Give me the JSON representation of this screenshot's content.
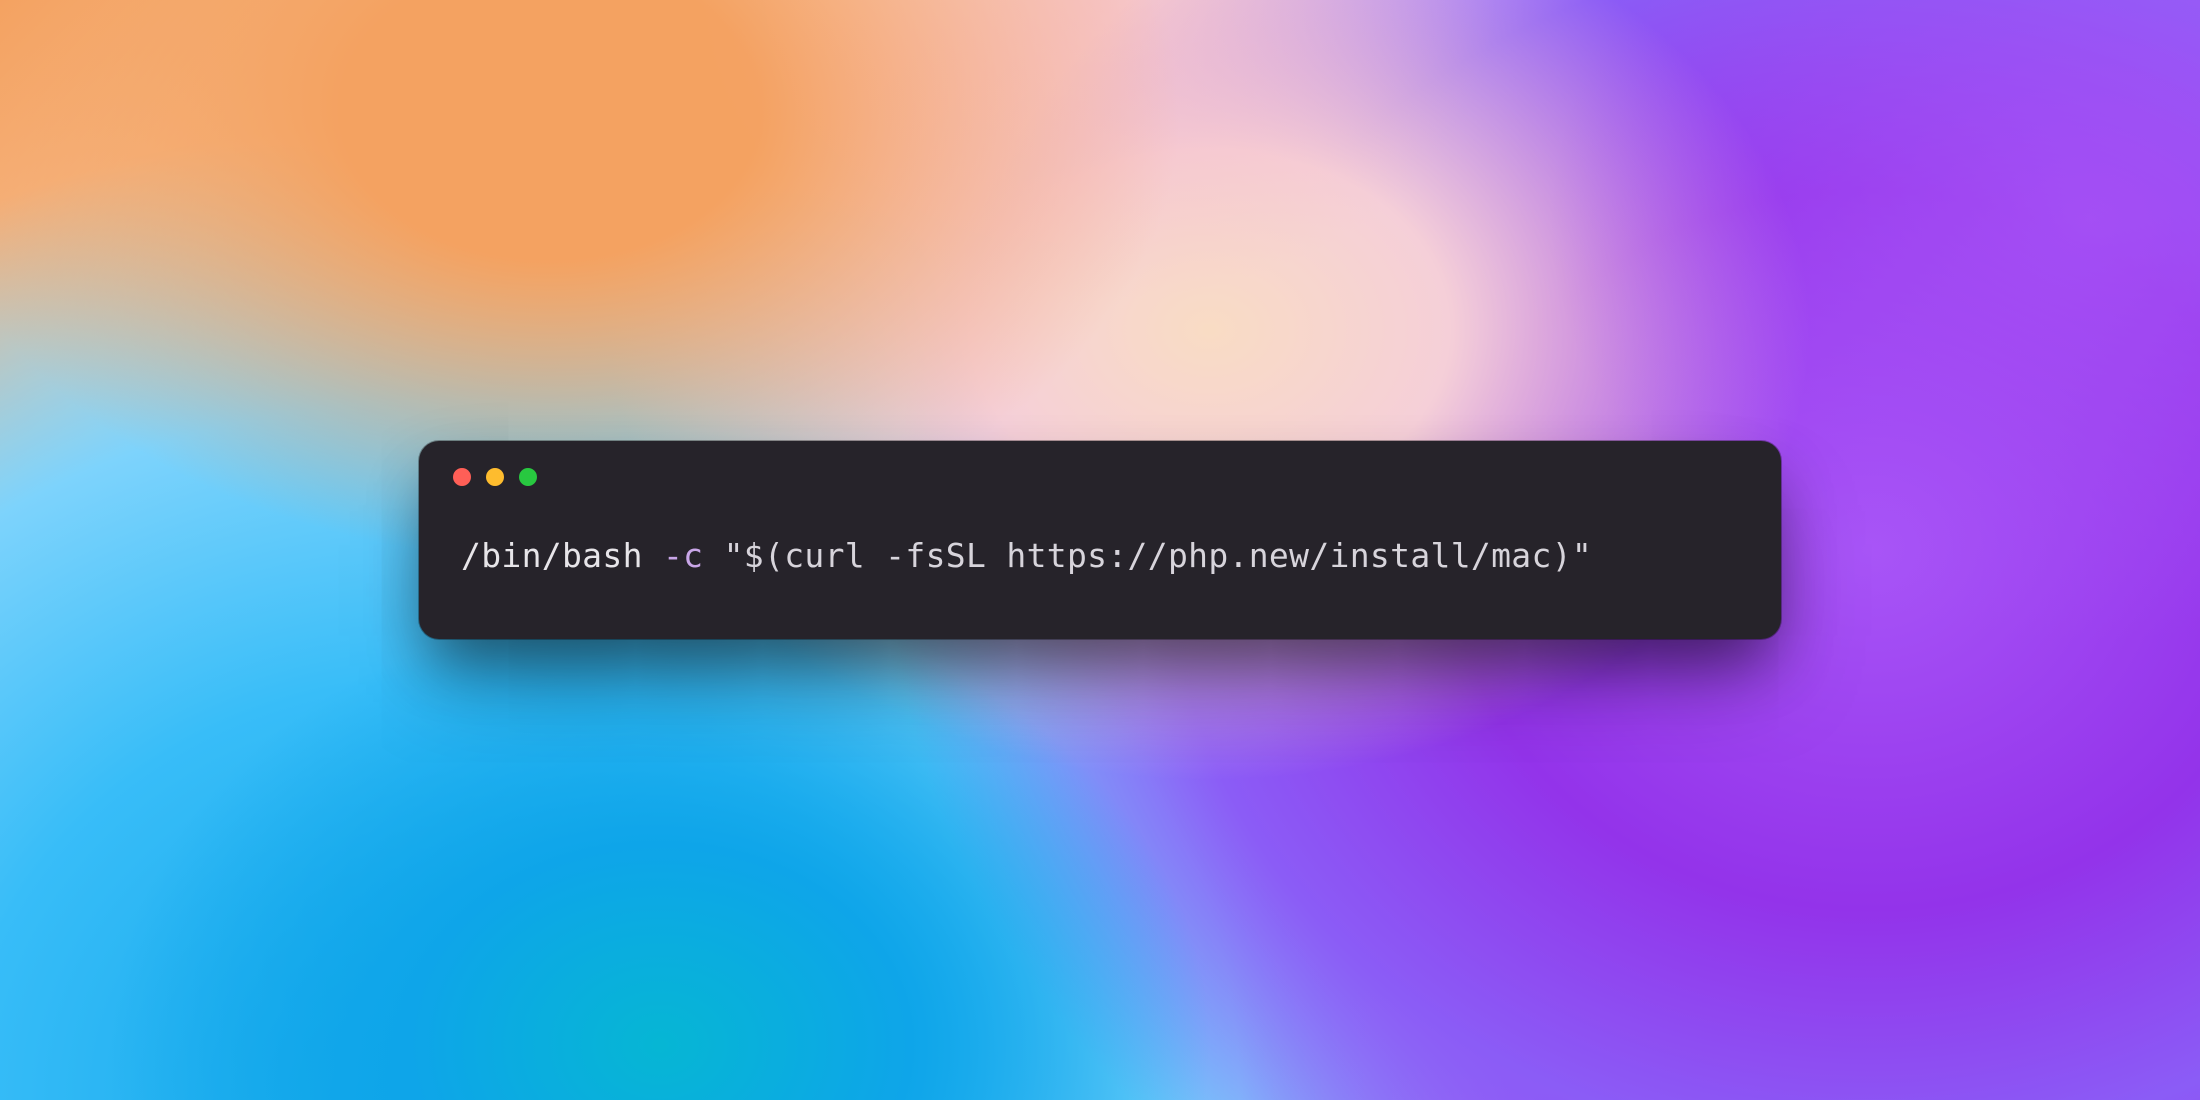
{
  "wallpaper": {
    "colors": {
      "orange": "#f4a261",
      "peach": "#f9dcc4",
      "pink": "#f5cfd8",
      "purple": "#a855f7",
      "deep_purple": "#9333ea",
      "blue": "#0ea5e9",
      "cyan": "#06b6d4"
    }
  },
  "terminal": {
    "traffic_lights": {
      "close_color": "#ff5f57",
      "minimize_color": "#febc2e",
      "zoom_color": "#28c840"
    },
    "command": {
      "tokens": {
        "path": "/bin/bash ",
        "flag": "-c",
        "space": " ",
        "open_quote": "\"",
        "body": "$(curl -fsSL https://php.new/install/mac)",
        "close_quote": "\""
      },
      "full": "/bin/bash -c \"$(curl -fsSL https://php.new/install/mac)\""
    }
  }
}
